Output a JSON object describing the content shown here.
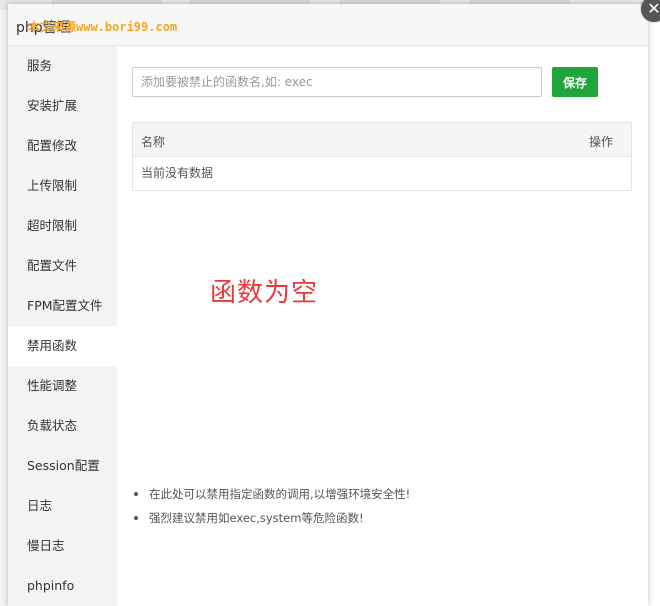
{
  "dialog": {
    "title": "php管理",
    "watermark": "本文来源www.bori99.com",
    "close_glyph": "✕"
  },
  "sidebar": {
    "items": [
      {
        "label": "服务"
      },
      {
        "label": "安装扩展"
      },
      {
        "label": "配置修改"
      },
      {
        "label": "上传限制"
      },
      {
        "label": "超时限制"
      },
      {
        "label": "配置文件"
      },
      {
        "label": "FPM配置文件"
      },
      {
        "label": "禁用函数",
        "active": true
      },
      {
        "label": "性能调整"
      },
      {
        "label": "负载状态"
      },
      {
        "label": "Session配置"
      },
      {
        "label": "日志"
      },
      {
        "label": "慢日志"
      },
      {
        "label": "phpinfo"
      }
    ]
  },
  "form": {
    "input_placeholder": "添加要被禁止的函数名,如: exec",
    "input_value": "",
    "save_label": "保存"
  },
  "table": {
    "columns": [
      "名称",
      "操作"
    ],
    "empty_text": "当前没有数据"
  },
  "annotation": "函数为空",
  "tips": [
    "在此处可以禁用指定函数的调用,以增强环境安全性!",
    "强烈建议禁用如exec,system等危险函数!"
  ],
  "colors": {
    "accent": "#20a53a",
    "annotation": "#e8393d",
    "watermark": "#f5a623"
  }
}
